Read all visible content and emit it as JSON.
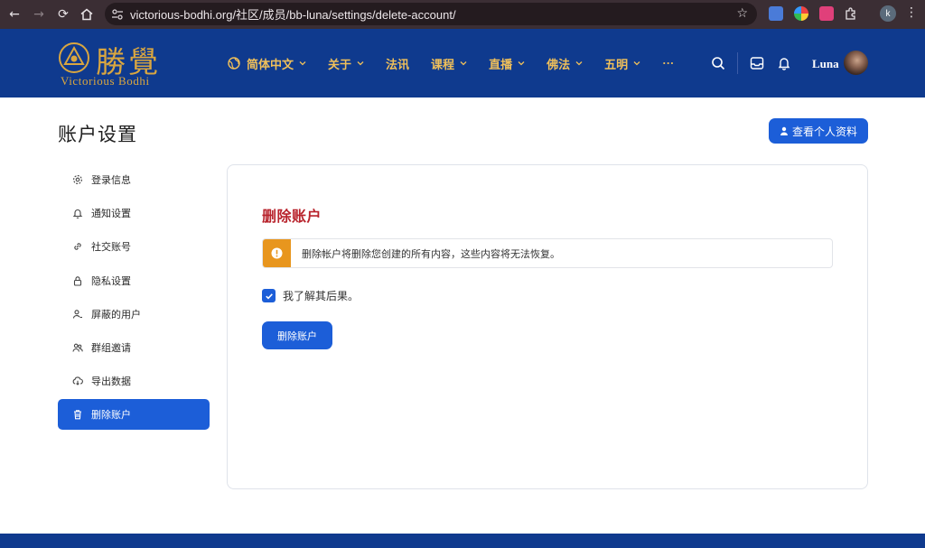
{
  "browser": {
    "url": "victorious-bodhi.org/社区/成员/bb-luna/settings/delete-account/",
    "profile_initial": "k"
  },
  "site": {
    "logo_text": "勝覺",
    "logo_sub": "Victorious Bodhi",
    "menu": [
      {
        "label": "简体中文",
        "dropdown": true,
        "icon": "globe-icon"
      },
      {
        "label": "关于",
        "dropdown": true
      },
      {
        "label": "法讯",
        "dropdown": false
      },
      {
        "label": "课程",
        "dropdown": true
      },
      {
        "label": "直播",
        "dropdown": true
      },
      {
        "label": "佛法",
        "dropdown": true
      },
      {
        "label": "五明",
        "dropdown": true
      },
      {
        "label": "···",
        "dropdown": false
      }
    ],
    "username": "Luna",
    "colors": {
      "header_bg": "#0f3a8e",
      "accent_gold": "#d9a640",
      "primary": "#1c5ed8",
      "danger_title": "#b8232c",
      "warning": "#e8961e"
    }
  },
  "page": {
    "title": "账户设置",
    "view_profile_label": "查看个人资料"
  },
  "sidebar": {
    "items": [
      {
        "label": "登录信息",
        "icon": "gear-icon",
        "active": false
      },
      {
        "label": "通知设置",
        "icon": "bell-icon",
        "active": false
      },
      {
        "label": "社交账号",
        "icon": "link-icon",
        "active": false
      },
      {
        "label": "隐私设置",
        "icon": "lock-icon",
        "active": false
      },
      {
        "label": "屏蔽的用户",
        "icon": "user-block-icon",
        "active": false
      },
      {
        "label": "群组邀请",
        "icon": "users-icon",
        "active": false
      },
      {
        "label": "导出数据",
        "icon": "cloud-download-icon",
        "active": false
      },
      {
        "label": "删除账户",
        "icon": "trash-icon",
        "active": true
      }
    ]
  },
  "panel": {
    "title": "删除账户",
    "warning_text": "删除帐户将删除您创建的所有内容，这些内容将无法恢复。",
    "consent_label": "我了解其后果。",
    "consent_checked": true,
    "delete_button_label": "删除账户"
  }
}
